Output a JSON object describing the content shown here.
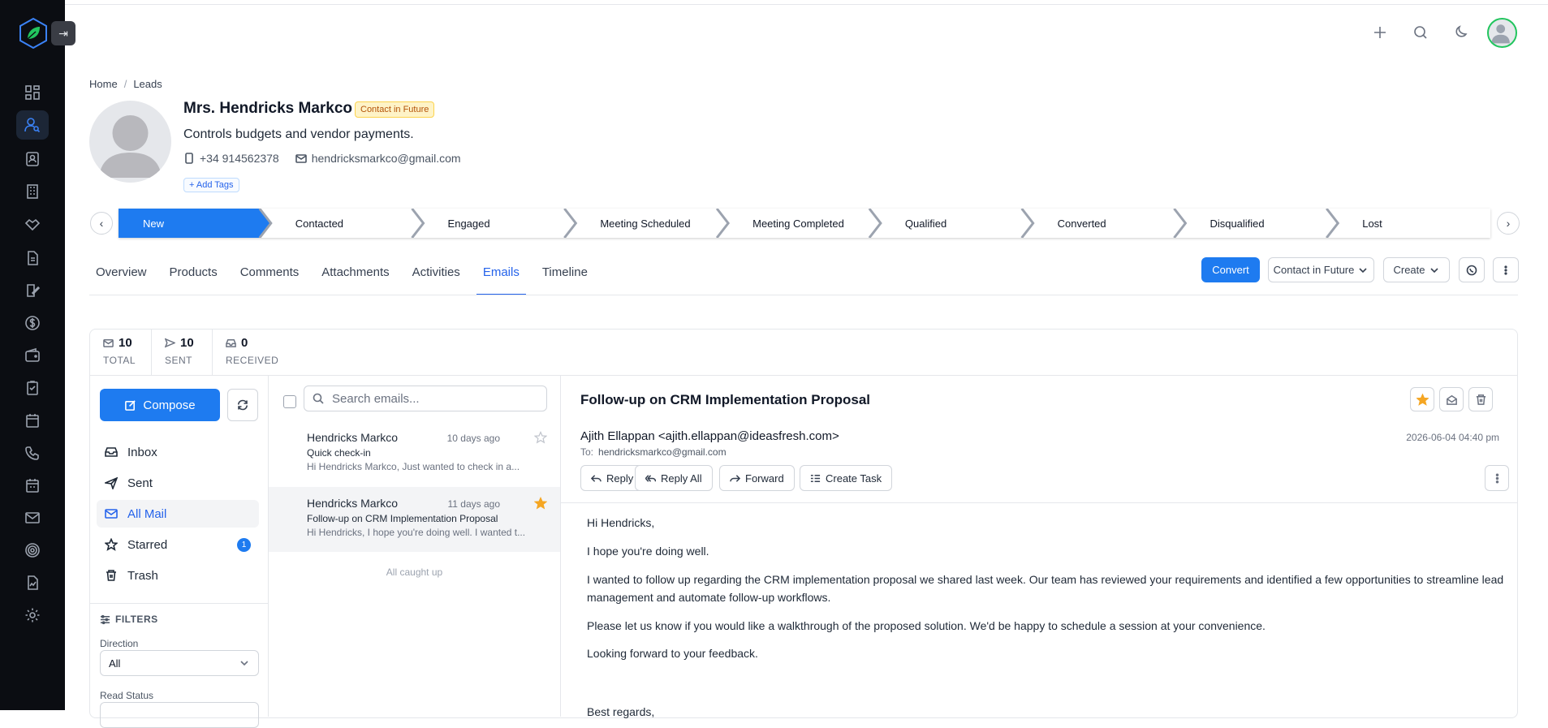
{
  "breadcrumb": [
    "Home",
    "Leads"
  ],
  "lead": {
    "name": "Mrs. Hendricks Markco",
    "status": "Contact in Future",
    "description": "Controls budgets and vendor payments.",
    "phone": "+34 914562378",
    "email": "hendricksmarkco@gmail.com",
    "add_tags": "+ Add Tags"
  },
  "pipeline": {
    "stages": [
      "New",
      "Contacted",
      "Engaged",
      "Meeting Scheduled",
      "Meeting Completed",
      "Qualified",
      "Converted",
      "Disqualified",
      "Lost"
    ],
    "active_index": 0,
    "active_color": "#1e7bf0"
  },
  "tabs": [
    "Overview",
    "Products",
    "Comments",
    "Attachments",
    "Activities",
    "Emails",
    "Timeline"
  ],
  "active_tab": "Emails",
  "actions": {
    "convert": "Convert",
    "status_dropdown": "Contact in Future",
    "create": "Create"
  },
  "stats": [
    {
      "value": "10",
      "label": "TOTAL",
      "icon": "mail-icon"
    },
    {
      "value": "10",
      "label": "SENT",
      "icon": "send-icon"
    },
    {
      "value": "0",
      "label": "RECEIVED",
      "icon": "inbox-icon"
    }
  ],
  "mailbox": {
    "compose": "Compose",
    "folders": [
      {
        "label": "Inbox",
        "icon": "inbox-icon"
      },
      {
        "label": "Sent",
        "icon": "send-icon"
      },
      {
        "label": "All Mail",
        "icon": "mail-icon"
      },
      {
        "label": "Starred",
        "icon": "star-icon",
        "badge": "1"
      },
      {
        "label": "Trash",
        "icon": "trash-icon"
      }
    ],
    "active_folder": "All Mail",
    "filters_title": "FILTERS",
    "direction_label": "Direction",
    "direction_value": "All",
    "read_status_label": "Read Status"
  },
  "list": {
    "search_placeholder": "Search emails...",
    "emails": [
      {
        "from": "Hendricks Markco",
        "date": "10 days ago",
        "subject": "Quick check-in",
        "snippet": "Hi Hendricks Markco, Just wanted to check in a...",
        "starred": false
      },
      {
        "from": "Hendricks Markco",
        "date": "11 days ago",
        "subject": "Follow-up on CRM Implementation Proposal",
        "snippet": "Hi Hendricks, I hope you're doing well. I wanted t...",
        "starred": true
      }
    ],
    "caught_up": "All caught up"
  },
  "detail": {
    "subject": "Follow-up on CRM Implementation Proposal",
    "from": "Ajith Ellappan <ajith.ellappan@ideasfresh.com>",
    "to_label": "To:",
    "to": "hendricksmarkco@gmail.com",
    "date": "2026-06-04 04:40 pm",
    "buttons": {
      "reply": "Reply",
      "reply_all": "Reply All",
      "forward": "Forward",
      "create_task": "Create Task"
    },
    "body": [
      "Hi Hendricks,",
      "I hope you're doing well.",
      "I wanted to follow up regarding the CRM implementation proposal we shared last week. Our team has reviewed your requirements and identified a few opportunities to streamline lead management and automate follow-up workflows.",
      "Please let us know if you would like a walkthrough of the proposed solution. We'd be happy to schedule a session at your convenience.",
      "Looking forward to your feedback.",
      "Best regards,"
    ]
  },
  "colors": {
    "accent": "#1e7bf0",
    "star": "#f5a623",
    "sidebar": "#0b0d12"
  }
}
